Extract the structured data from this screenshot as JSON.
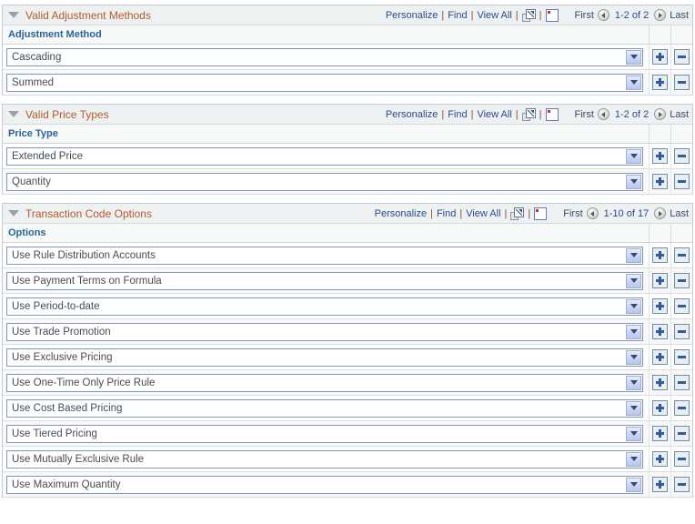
{
  "toolbar": {
    "personalize_label": "Personalize",
    "find_label": "Find",
    "view_all_label": "View All",
    "separator": "|",
    "first_label": "First",
    "last_label": "Last"
  },
  "sections": [
    {
      "title": "Valid Adjustment Methods",
      "column_header": "Adjustment Method",
      "page_range": "1-2 of 2",
      "rows": [
        {
          "value": "Cascading"
        },
        {
          "value": "Summed"
        }
      ]
    },
    {
      "title": "Valid Price Types",
      "column_header": "Price Type",
      "page_range": "1-2 of 2",
      "rows": [
        {
          "value": "Extended Price"
        },
        {
          "value": "Quantity"
        }
      ]
    },
    {
      "title": "Transaction Code Options",
      "column_header": "Options",
      "page_range": "1-10 of 17",
      "rows": [
        {
          "value": "Use Rule Distribution Accounts"
        },
        {
          "value": "Use Payment Terms on Formula"
        },
        {
          "value": "Use Period-to-date"
        },
        {
          "value": "Use Trade Promotion"
        },
        {
          "value": "Use Exclusive Pricing"
        },
        {
          "value": "Use One-Time Only Price Rule"
        },
        {
          "value": "Use Cost Based Pricing"
        },
        {
          "value": "Use Tiered Pricing"
        },
        {
          "value": "Use Mutually Exclusive Rule"
        },
        {
          "value": "Use Maximum Quantity"
        }
      ]
    }
  ],
  "icons": {
    "collapse": "triangle-down-icon",
    "expand_window": "expand-to-window-icon",
    "download_grid": "download-to-spreadsheet-icon",
    "prev": "previous-page-icon",
    "next": "next-page-icon",
    "add_row": "add-row-icon",
    "delete_row": "delete-row-icon",
    "dropdown": "chevron-down-icon"
  },
  "colors": {
    "title": "#b55a2b",
    "column_header": "#2a6496",
    "link": "#2a4b8d",
    "separator": "#8c4a3a",
    "header_bg": "#eef1f2",
    "button_glyph": "#2f5d9e"
  }
}
